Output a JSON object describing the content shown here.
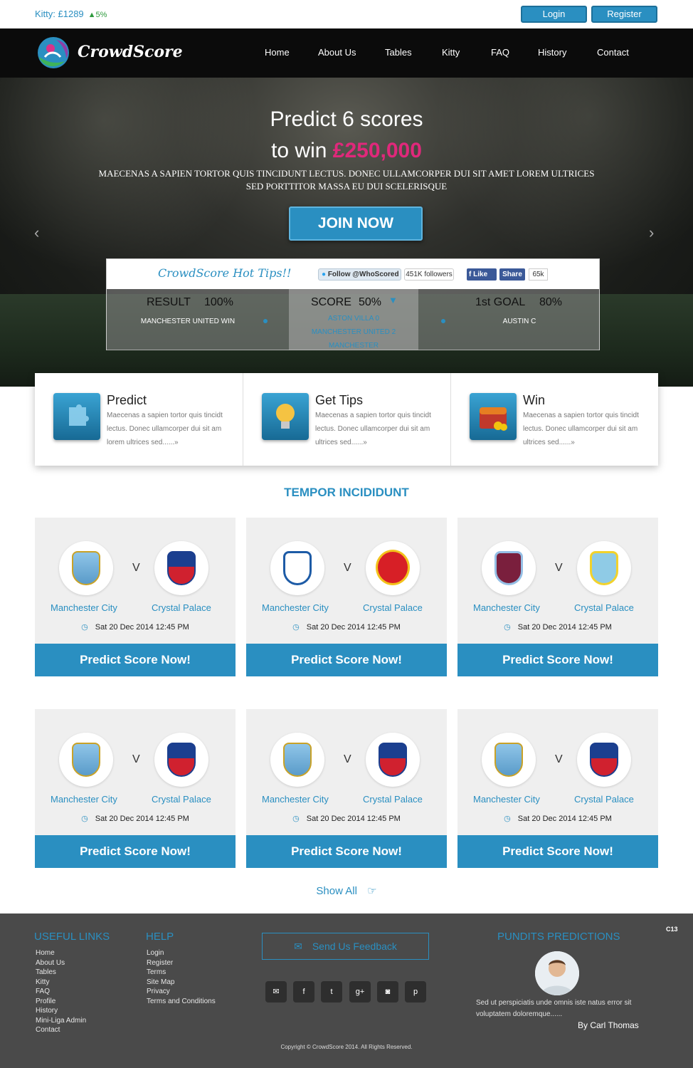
{
  "topbar": {
    "kitty_label": "Kitty:  £1289",
    "kitty_change": "▲5%",
    "login": "Login",
    "register": "Register"
  },
  "nav": {
    "logo": "CrowdScore",
    "items": [
      "Home",
      "About Us",
      "Tables",
      "Kitty",
      "FAQ",
      "History",
      "Contact"
    ]
  },
  "hero": {
    "line1": "Predict 6 scores",
    "line2_prefix": "to win ",
    "prize": "£250,000",
    "subtitle": "MAECENAS A SAPIEN TORTOR QUIS TINCIDUNT LECTUS. DONEC ULLAMCORPER DUI SIT AMET LOREM ULTRICES SED PORTTITOR MASSA EU DUI SCELERISQUE",
    "join": "JOIN NOW",
    "prev": "‹",
    "next": "›"
  },
  "tips": {
    "title": "CrowdScore Hot Tips!!",
    "twitter_follow": "Follow @WhoScored",
    "twitter_count": "451K followers",
    "fb_like": "Like",
    "fb_share": "Share",
    "fb_count": "65k",
    "result_label": "RESULT",
    "result_pct": "100%",
    "result_line": "MANCHESTER UNITED WIN",
    "score_label": "SCORE",
    "score_pct": "50%",
    "score_lines": [
      "ASTON VILLA 0",
      "MANCHESTER UNITED 2",
      "MANCHESTER"
    ],
    "goal_label": "1st GOAL",
    "goal_pct": "80%",
    "goal_line": "AUSTIN C"
  },
  "features": [
    {
      "title": "Predict",
      "text": "Maecenas a sapien tortor quis tincidt lectus. Donec ullamcorper dui sit am lorem ultrices sed......»",
      "icon": "puzzle-icon"
    },
    {
      "title": "Get Tips",
      "text": "Maecenas a sapien tortor quis tincidt lectus. Donec ullamcorper dui sit am ultrices sed......»",
      "icon": "lightbulb-icon"
    },
    {
      "title": "Win",
      "text": "Maecenas a sapien tortor quis tincidt lectus. Donec ullamcorper dui sit am ultrices sed......»",
      "icon": "treasure-chest-icon"
    }
  ],
  "section_title": "TEMPOR INCIDIDUNT",
  "matches": [
    {
      "home": "Manchester City",
      "away": "Crystal Palace",
      "date": "Sat 20 Dec 2014 12:45 PM",
      "v": "V",
      "cta": "Predict Score Now!"
    },
    {
      "home": "Manchester City",
      "away": "Crystal Palace",
      "date": "Sat 20 Dec 2014 12:45 PM",
      "v": "V",
      "cta": "Predict Score Now!"
    },
    {
      "home": "Manchester City",
      "away": "Crystal Palace",
      "date": "Sat 20 Dec 2014 12:45 PM",
      "v": "V",
      "cta": "Predict Score Now!"
    },
    {
      "home": "Manchester City",
      "away": "Crystal Palace",
      "date": "Sat 20 Dec 2014 12:45 PM",
      "v": "V",
      "cta": "Predict Score Now!"
    },
    {
      "home": "Manchester City",
      "away": "Crystal Palace",
      "date": "Sat 20 Dec 2014 12:45 PM",
      "v": "V",
      "cta": "Predict Score Now!"
    },
    {
      "home": "Manchester City",
      "away": "Crystal Palace",
      "date": "Sat 20 Dec 2014 12:45 PM",
      "v": "V",
      "cta": "Predict Score Now!"
    }
  ],
  "show_all": "Show All",
  "footer": {
    "useful_links_title": "USEFUL LINKS",
    "useful_links": [
      "Home",
      "About Us",
      "Tables",
      "Kitty",
      "FAQ",
      "Profile",
      "History",
      "Mini-Liga Admin",
      "Contact"
    ],
    "help_title": "HELP",
    "help_links": [
      "Login",
      "Register",
      "Terms",
      "Site Map",
      "Privacy",
      "Terms and Conditions"
    ],
    "feedback": "Send Us Feedback",
    "pundits_title": "PUNDITS PREDICTIONS",
    "quote": "Sed ut perspiciatis unde omnis iste natus error sit voluptatem  doloremque......",
    "byline": "By Carl Thomas",
    "copyright": "Copyright © CrowdScore 2014. All Rights Reserved.",
    "badge": "C13"
  },
  "colors": {
    "accent": "#2a8fc1",
    "prize": "#e0287b",
    "nav_bg": "#0b0b0b",
    "footer_bg": "#4a4a4a"
  }
}
